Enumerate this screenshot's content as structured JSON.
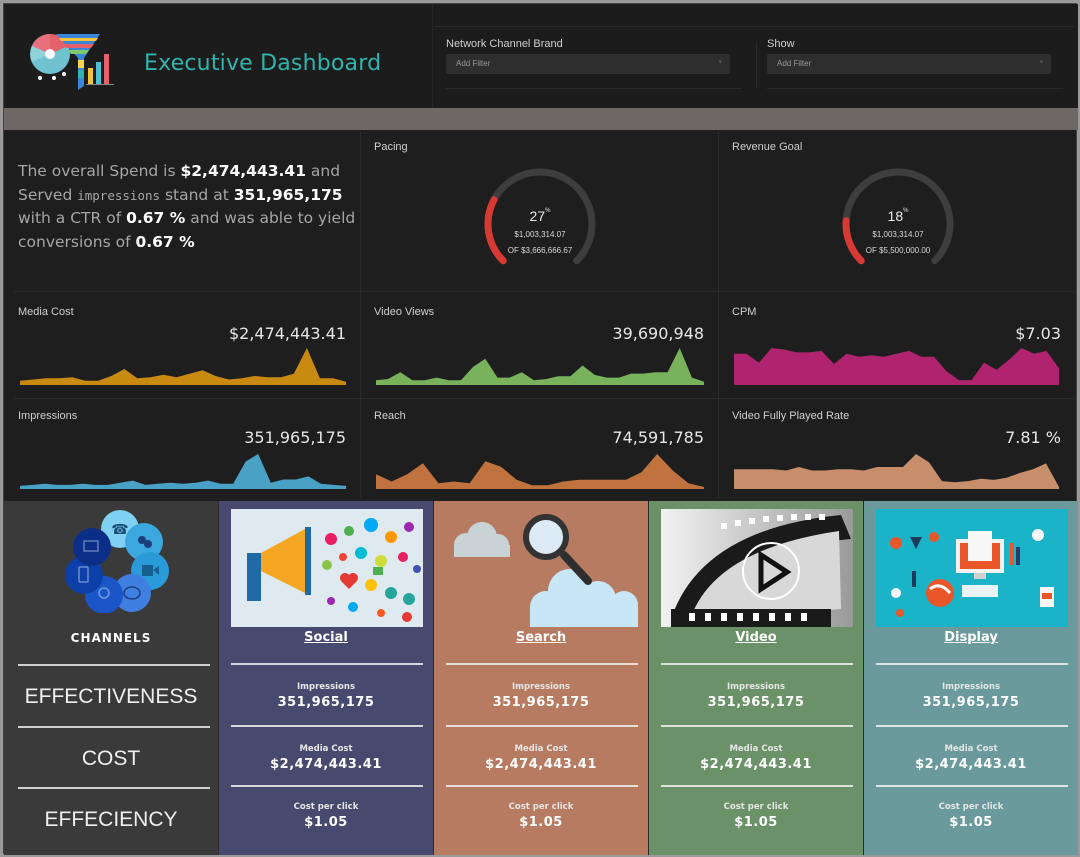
{
  "header": {
    "title": "Executive Dashboard",
    "logo_icon": "funnel-chart-logo-icon",
    "filters": [
      {
        "label": "Network Channel Brand",
        "placeholder": "Add Filter"
      },
      {
        "label": "Show",
        "placeholder": "Add Filter"
      }
    ]
  },
  "summary": {
    "t1": "The overall Spend is ",
    "spend": "$2,474,443.41",
    "t2": " and Served ",
    "impr_word": "impressions",
    "t3": " stand at ",
    "impressions": "351,965,175",
    "t4": " with a CTR of ",
    "ctr": "0.67 %",
    "t5": " and was able to yield conversions of ",
    "conversions": "0.67 %"
  },
  "gauges": [
    {
      "label": "Pacing",
      "percent": 27,
      "pct_text": "27",
      "pct_sup": "%",
      "value": "$1,003,314.07",
      "of": "OF $3,666,666.67",
      "fill_color": "#d63a32",
      "track_color": "#3e3e3e"
    },
    {
      "label": "Revenue Goal",
      "percent": 18,
      "pct_text": "18",
      "pct_sup": "%",
      "value": "$1,003,314.07",
      "of": "OF $5,500,000.00",
      "fill_color": "#d63a32",
      "track_color": "#3e3e3e"
    }
  ],
  "kpis": [
    {
      "label": "Media Cost",
      "value": "$2,474,443.41",
      "color": "#c98a12",
      "series": [
        2,
        3,
        4,
        4,
        5,
        2,
        2,
        6,
        12,
        4,
        5,
        7,
        5,
        8,
        11,
        6,
        3,
        4,
        6,
        5,
        5,
        8,
        30,
        4,
        4,
        1
      ]
    },
    {
      "label": "Video Views",
      "value": "39,690,948",
      "color": "#78b35c",
      "series": [
        2,
        3,
        8,
        2,
        2,
        4,
        2,
        2,
        12,
        18,
        4,
        4,
        8,
        2,
        3,
        5,
        5,
        13,
        6,
        4,
        4,
        7,
        7,
        8,
        8,
        26,
        4,
        1
      ]
    },
    {
      "label": "CPM",
      "value": "$7.03",
      "color": "#b0246f",
      "series": [
        20,
        20,
        14,
        24,
        23,
        21,
        21,
        22,
        13,
        20,
        18,
        19,
        18,
        20,
        22,
        18,
        18,
        8,
        2,
        2,
        14,
        9,
        16,
        24,
        20,
        22,
        10
      ]
    },
    {
      "label": "Impressions",
      "value": "351,965,175",
      "color": "#4aa1c6",
      "series": [
        1,
        2,
        3,
        2,
        2,
        3,
        2,
        2,
        4,
        6,
        2,
        3,
        4,
        3,
        4,
        6,
        3,
        3,
        24,
        31,
        4,
        7,
        7,
        10,
        3,
        2,
        1
      ]
    },
    {
      "label": "Reach",
      "value": "74,591,785",
      "color": "#c0733e",
      "series": [
        7,
        3,
        7,
        13,
        2,
        3,
        2,
        14,
        11,
        4,
        1,
        1,
        3,
        4,
        4,
        4,
        4,
        8,
        18,
        9,
        2,
        0
      ]
    },
    {
      "label": "Video Fully Played Rate",
      "value": "7.81 %",
      "color": "#c78e6b",
      "series": [
        15,
        15,
        15,
        15,
        14,
        17,
        14,
        14,
        15,
        15,
        14,
        17,
        17,
        17,
        28,
        21,
        5,
        4,
        5,
        7,
        6,
        8,
        12,
        15,
        20,
        0
      ]
    }
  ],
  "channels": {
    "title": "CHANNELS",
    "icon": "communication-channels-icon",
    "rows": [
      "EFFECTIVENESS",
      "COST",
      "EFFECIENCY"
    ]
  },
  "cards": [
    {
      "name": "Social",
      "image": "megaphone-social-icons-image",
      "bg": "#474a6e",
      "impressions_label": "Impressions",
      "impressions": "351,965,175",
      "cost_label": "Media Cost",
      "cost": "$2,474,443.41",
      "cpc_label": "Cost per click",
      "cpc": "$1.05"
    },
    {
      "name": "Search",
      "image": "magnifier-clouds-image",
      "bg": "#b77b62",
      "impressions_label": "Impressions",
      "impressions": "351,965,175",
      "cost_label": "Media Cost",
      "cost": "$2,474,443.41",
      "cpc_label": "Cost per click",
      "cpc": "$1.05"
    },
    {
      "name": "Video",
      "image": "film-strip-play-image",
      "bg": "#6a9168",
      "impressions_label": "Impressions",
      "impressions": "351,965,175",
      "cost_label": "Media Cost",
      "cost": "$2,474,443.41",
      "cpc_label": "Cost per click",
      "cpc": "$1.05"
    },
    {
      "name": "Display",
      "image": "desktop-display-icons-image",
      "bg": "#6a9a9c",
      "impressions_label": "Impressions",
      "impressions": "351,965,175",
      "cost_label": "Media Cost",
      "cost": "$2,474,443.41",
      "cpc_label": "Cost per click",
      "cpc": "$1.05"
    }
  ]
}
